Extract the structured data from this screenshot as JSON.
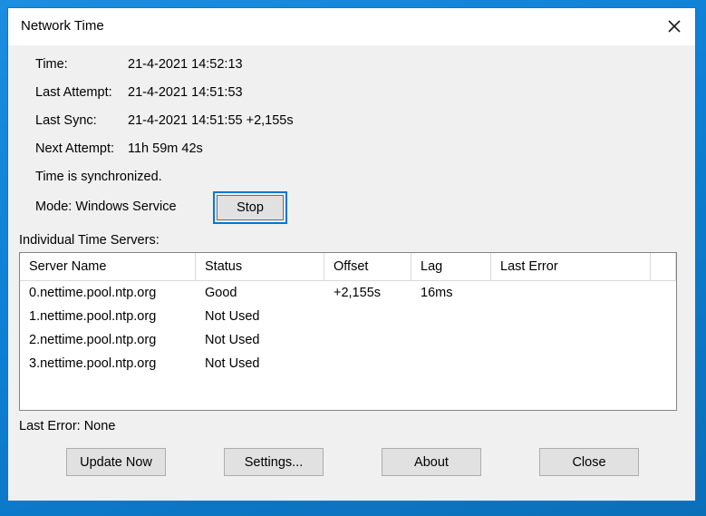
{
  "window": {
    "title": "Network Time",
    "close_icon": "close-icon",
    "accent_color": "#0078d7",
    "body_color": "#f0f0f0",
    "titlebar_color": "#ffffff"
  },
  "info": {
    "rows": [
      {
        "label": "Time:",
        "value": "21-4-2021 14:52:13"
      },
      {
        "label": "Last Attempt:",
        "value": "21-4-2021 14:51:53"
      },
      {
        "label": "Last Sync:",
        "value": "21-4-2021 14:51:55 +2,155s"
      },
      {
        "label": "Next Attempt:",
        "value": "11h 59m 42s"
      }
    ],
    "status_text": "Time is synchronized.",
    "mode_text": "Mode: Windows Service",
    "stop_button": "Stop"
  },
  "servers": {
    "group_label": "Individual Time Servers:",
    "columns": [
      "Server Name",
      "Status",
      "Offset",
      "Lag",
      "Last Error"
    ],
    "rows": [
      {
        "server": "0.nettime.pool.ntp.org",
        "status": "Good",
        "offset": "+2,155s",
        "lag": "16ms",
        "error": ""
      },
      {
        "server": "1.nettime.pool.ntp.org",
        "status": "Not Used",
        "offset": "",
        "lag": "",
        "error": ""
      },
      {
        "server": "2.nettime.pool.ntp.org",
        "status": "Not Used",
        "offset": "",
        "lag": "",
        "error": ""
      },
      {
        "server": "3.nettime.pool.ntp.org",
        "status": "Not Used",
        "offset": "",
        "lag": "",
        "error": ""
      }
    ]
  },
  "footer": {
    "last_error": "Last Error:  None",
    "buttons": {
      "update": "Update Now",
      "settings": "Settings...",
      "about": "About",
      "close": "Close"
    }
  }
}
